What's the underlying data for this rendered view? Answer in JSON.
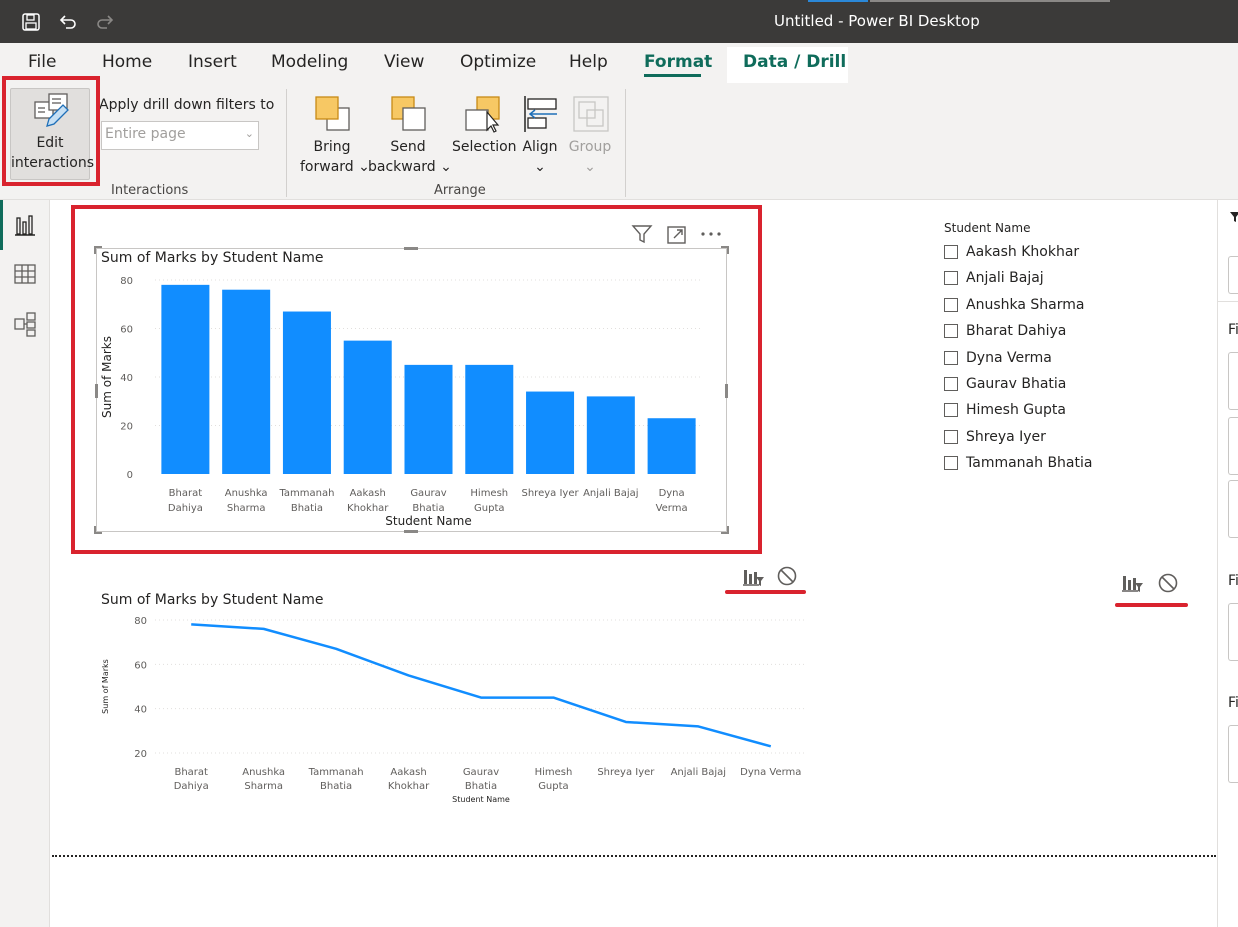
{
  "window": {
    "title": "Untitled - Power BI Desktop"
  },
  "titlebar_icons": [
    "save-icon",
    "undo-icon",
    "redo-icon"
  ],
  "tabs": [
    {
      "label": "File"
    },
    {
      "label": "Home"
    },
    {
      "label": "Insert"
    },
    {
      "label": "Modeling"
    },
    {
      "label": "View"
    },
    {
      "label": "Optimize"
    },
    {
      "label": "Help"
    },
    {
      "label": "Format"
    },
    {
      "label": "Data / Drill"
    }
  ],
  "active_tab": "Format",
  "ribbon": {
    "edit_interactions": {
      "line1": "Edit",
      "line2": "interactions"
    },
    "apply_drill_label": "Apply drill down filters to",
    "apply_drill_value": "Entire page",
    "interactions_group": "Interactions",
    "bring_forward": {
      "line1": "Bring",
      "line2": "forward"
    },
    "send_backward": {
      "line1": "Send",
      "line2": "backward"
    },
    "selection": "Selection",
    "align": "Align",
    "group": "Group",
    "arrange_group": "Arrange"
  },
  "bar_chart": {
    "title": "Sum of Marks by Student Name",
    "chart_data": {
      "type": "bar",
      "title": "Sum of Marks by Student Name",
      "xlabel": "Student Name",
      "ylabel": "Sum of Marks",
      "categories": [
        [
          "Bharat",
          "Dahiya"
        ],
        [
          "Anushka",
          "Sharma"
        ],
        [
          "Tammanah",
          "Bhatia"
        ],
        [
          "Aakash",
          "Khokhar"
        ],
        [
          "Gaurav",
          "Bhatia"
        ],
        [
          "Himesh",
          "Gupta"
        ],
        [
          "Shreya Iyer"
        ],
        [
          "Anjali Bajaj"
        ],
        [
          "Dyna",
          "Verma"
        ]
      ],
      "values": [
        78,
        76,
        67,
        55,
        45,
        45,
        34,
        32,
        23
      ],
      "ylim": [
        0,
        80
      ],
      "yticks": [
        0,
        20,
        40,
        60,
        80
      ],
      "color": "#118dff",
      "grid": true
    }
  },
  "line_chart": {
    "title": "Sum of Marks by Student Name",
    "chart_data": {
      "type": "line",
      "title": "Sum of Marks by Student Name",
      "xlabel": "Student Name",
      "ylabel": "Sum of Marks",
      "categories": [
        [
          "Bharat",
          "Dahiya"
        ],
        [
          "Anushka",
          "Sharma"
        ],
        [
          "Tammanah",
          "Bhatia"
        ],
        [
          "Aakash",
          "Khokhar"
        ],
        [
          "Gaurav",
          "Bhatia"
        ],
        [
          "Himesh",
          "Gupta"
        ],
        [
          "Shreya Iyer"
        ],
        [
          "Anjali Bajaj"
        ],
        [
          "Dyna Verma"
        ]
      ],
      "values": [
        78,
        76,
        67,
        55,
        45,
        45,
        34,
        32,
        23
      ],
      "ylim": [
        20,
        80
      ],
      "yticks": [
        20,
        40,
        60,
        80
      ],
      "color": "#118dff",
      "grid": true
    }
  },
  "slicer": {
    "title": "Student Name",
    "items": [
      "Aakash Khokhar",
      "Anjali Bajaj",
      "Anushka Sharma",
      "Bharat Dahiya",
      "Dyna Verma",
      "Gaurav Bhatia",
      "Himesh Gupta",
      "Shreya Iyer",
      "Tammanah Bhatia"
    ]
  },
  "right_pane": {
    "labels": [
      "Fi",
      "Fi",
      "Fi"
    ]
  },
  "visual_header_icons": [
    "filter-icon",
    "focus-mode-icon",
    "more-options-icon"
  ],
  "interaction_icons": [
    "filter-interaction-icon",
    "none-interaction-icon"
  ],
  "colors": {
    "accent": "#0f6c5b",
    "highlight": "#d9232e",
    "series": "#118dff"
  }
}
